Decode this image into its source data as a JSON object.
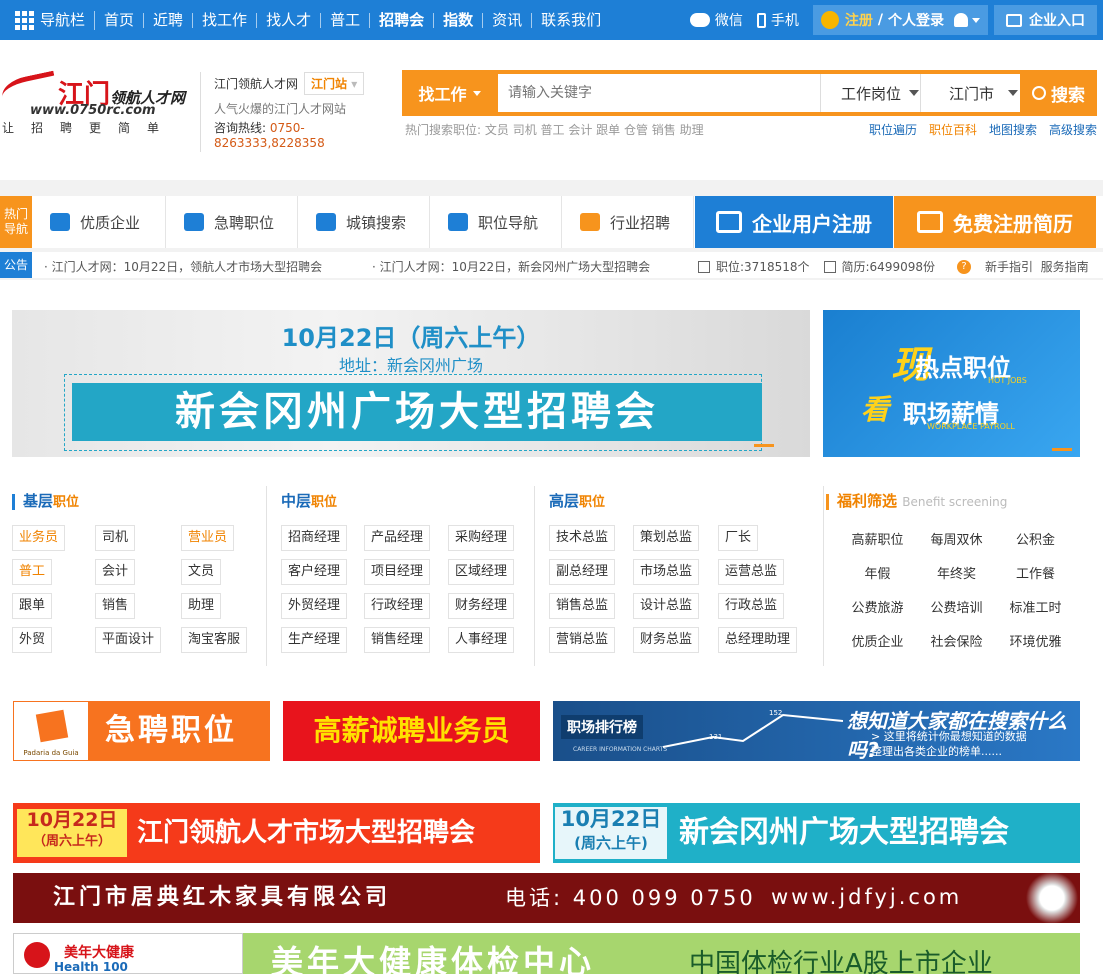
{
  "topbar": {
    "nav_label": "导航栏",
    "items": [
      {
        "label": "首页",
        "bold": false
      },
      {
        "label": "近聘",
        "bold": false
      },
      {
        "label": "找工作",
        "bold": false
      },
      {
        "label": "找人才",
        "bold": false
      },
      {
        "label": "普工",
        "bold": false
      },
      {
        "label": "招聘会",
        "bold": true
      },
      {
        "label": "指数",
        "bold": true
      },
      {
        "label": "资讯",
        "bold": false
      },
      {
        "label": "联系我们",
        "bold": false
      }
    ],
    "wechat": "微信",
    "mobile": "手机",
    "register": "注册",
    "separator": "/",
    "login": "个人登录",
    "enterprise": "企业入口"
  },
  "header": {
    "logo_mark": "江门",
    "logo_script": "领航人才网",
    "logo_url": "www.0750rc.com",
    "logo_slogan": "让招聘更简单",
    "site_name": "江门领航人才网",
    "station": "江门站",
    "tagline": "人气火爆的江门人才网站",
    "hotline_label": "咨询热线:",
    "hotline": "0750-8263333,8228358"
  },
  "search": {
    "category": "找工作",
    "placeholder": "请输入关键字",
    "position_select": "工作岗位",
    "city_select": "江门市",
    "button": "搜索",
    "hot_label": "热门搜索职位:",
    "hot_terms": "文员 司机 普工 会计 跟单 仓管 销售 助理",
    "links": [
      "职位遍历",
      "职位百科",
      "地图搜索",
      "高级搜索"
    ]
  },
  "nav": {
    "hot_label": "热门导航",
    "tabs": [
      "优质企业",
      "急聘职位",
      "城镇搜索",
      "职位导航",
      "行业招聘"
    ],
    "enterprise_register": "企业用户注册",
    "free_resume": "免费注册简历"
  },
  "notice": {
    "label": "公告",
    "items": [
      "· 江门人才网：10月22日，领航人才市场大型招聘会",
      "· 江门人才网：10月22日，新会冈州广场大型招聘会"
    ],
    "jobs_stat": "职位:3718518个",
    "resume_stat": "简历:6499098份",
    "guide": "新手指引  服务指南"
  },
  "banner_main": {
    "date": "10月22日（周六上午）",
    "address": "地址：新会冈州广场",
    "title": "新会冈州广场大型招聘会"
  },
  "banner_side": {
    "kan": "现",
    "kan2": "看",
    "hot": "热点职位",
    "hot_en": "HOT JOBS",
    "salary": "职场薪情",
    "salary_en": "WORKPLACE PAYROLL"
  },
  "categories": {
    "basic": {
      "title": "基层",
      "suffix": "职位",
      "items": [
        {
          "label": "业务员",
          "hl": true
        },
        {
          "label": "司机",
          "hl": false
        },
        {
          "label": "营业员",
          "hl": true
        },
        {
          "label": "普工",
          "hl": true
        },
        {
          "label": "会计",
          "hl": false
        },
        {
          "label": "文员",
          "hl": false
        },
        {
          "label": "跟单",
          "hl": false
        },
        {
          "label": "销售",
          "hl": false
        },
        {
          "label": "助理",
          "hl": false
        },
        {
          "label": "外贸",
          "hl": false
        },
        {
          "label": "平面设计",
          "hl": false
        },
        {
          "label": "淘宝客服",
          "hl": false
        }
      ]
    },
    "middle": {
      "title": "中层",
      "suffix": "职位",
      "items": [
        "招商经理",
        "产品经理",
        "采购经理",
        "客户经理",
        "项目经理",
        "区域经理",
        "外贸经理",
        "行政经理",
        "财务经理",
        "生产经理",
        "销售经理",
        "人事经理"
      ]
    },
    "senior": {
      "title": "高层",
      "suffix": "职位",
      "items": [
        "技术总监",
        "策划总监",
        "厂长",
        "副总经理",
        "市场总监",
        "运营总监",
        "销售总监",
        "设计总监",
        "行政总监",
        "营销总监",
        "财务总监",
        "总经理助理"
      ]
    },
    "welfare": {
      "title": "福利筛选",
      "subtitle": "Benefit screening",
      "items": [
        "高薪职位",
        "每周双休",
        "公积金",
        "年假",
        "年终奖",
        "工作餐",
        "公费旅游",
        "公费培训",
        "标准工时",
        "优质企业",
        "社会保险",
        "环境优雅"
      ]
    }
  },
  "ads": {
    "urgent": "急聘职位",
    "urgent_logo": "Padaria da Guia",
    "salesman": "高薪诚聘业务员",
    "ranking": "职场排行榜",
    "ranking_en": "CAREER INFORMATION CHARTS",
    "ranking_n1": "131",
    "ranking_n2": "152",
    "ranking_q": "想知道大家都在搜索什么吗?",
    "ranking_q2": "> 这里将统计你最想知道的数据",
    "ranking_q3": "整理出各类企业的榜单......",
    "fair1_date": "10月22日",
    "fair1_time": "（周六上午）",
    "fair1_title": "江门领航人才市场大型招聘会",
    "fair2_date": "10月22日",
    "fair2_time": "(周六上午)",
    "fair2_title": "新会冈州广场大型招聘会",
    "furniture": "江门市居典红木家具有限公司",
    "furniture_tel": "电话: 400 099 0750",
    "furniture_url": "www.jdfyj.com",
    "health_logo": "美年大健康",
    "health_logo2": "Health 100",
    "health_title": "美年大健康体检中心",
    "health_sub": "中国体检行业A股上市企业"
  }
}
